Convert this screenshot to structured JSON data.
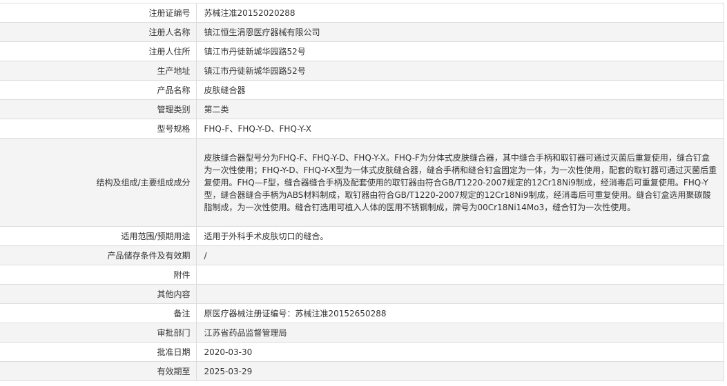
{
  "rows": [
    {
      "label": "注册证编号",
      "value": "苏械注准20152020288"
    },
    {
      "label": "注册人名称",
      "value": "镇江恒生涓恩医疗器械有限公司"
    },
    {
      "label": "注册人住所",
      "value": "镇江市丹徒新城华园路52号"
    },
    {
      "label": "生产地址",
      "value": "镇江市丹徒新城华园路52号"
    },
    {
      "label": "产品名称",
      "value": "皮肤缝合器"
    },
    {
      "label": "管理类别",
      "value": "第二类"
    },
    {
      "label": "型号规格",
      "value": "FHQ-F、FHQ-Y-D、FHQ-Y-X"
    },
    {
      "label": "结构及组成/主要组成成分",
      "value": "皮肤缝合器型号分为FHQ-F、FHQ-Y-D、FHQ-Y-X。FHQ-F为分体式皮肤缝合器，其中缝合手柄和取钉器可通过灭菌后重复使用，缝合钉盒为一次性使用；FHQ-Y-D、FHQ-Y-X型为一体式皮肤缝合器，缝合手柄和缝合钉盒固定为一体，为一次性使用，配套的取钉器可通过灭菌后重复使用。FHQ—F型，缝合器缝合手柄及配套使用的取钉器由符合GB/T1220-2007规定的12Cr18Ni9制成，经消毒后可重复使用。FHQ-Y型，缝合器缝合手柄为ABS材料制成，取钉器由符合GB/T1220-2007规定的12Cr18Ni9制成，经消毒后可重复使用。缝合钉盒选用聚碳酸脂制成，为一次性使用。缝合钉选用可植入人体的医用不锈钢制成，牌号为00Cr18Ni14Mo3，缝合钉为一次性使用。"
    },
    {
      "label": "适用范围/预期用途",
      "value": "适用于外科手术皮肤切口的缝合。"
    },
    {
      "label": "产品储存条件及有效期",
      "value": "/"
    },
    {
      "label": "附件",
      "value": ""
    },
    {
      "label": "其他内容",
      "value": ""
    },
    {
      "label": "备注",
      "value": "原医疗器械注册证编号：苏械注准20152650288"
    },
    {
      "label": "审批部门",
      "value": "江苏省药品监督管理局"
    },
    {
      "label": "批准日期",
      "value": "2020-03-30"
    },
    {
      "label": "有效期至",
      "value": "2025-03-29"
    }
  ]
}
